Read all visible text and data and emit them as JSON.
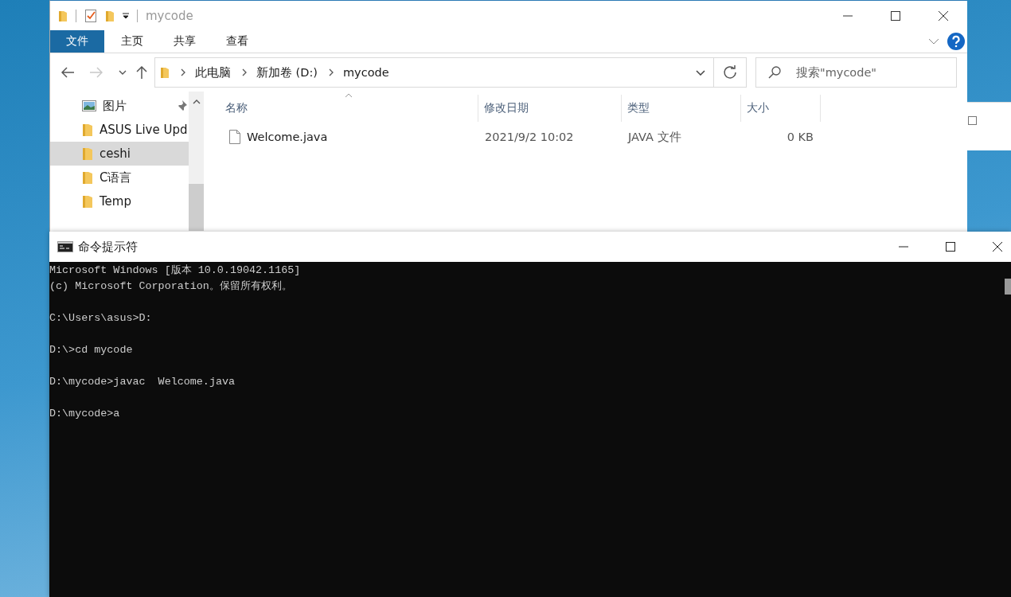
{
  "explorer": {
    "title": "mycode",
    "ribbon_tabs": [
      {
        "label": "文件",
        "kind": "file_menu"
      },
      {
        "label": "主页",
        "kind": "tab"
      },
      {
        "label": "共享",
        "kind": "tab"
      },
      {
        "label": "查看",
        "kind": "tab"
      }
    ],
    "breadcrumb": [
      "此电脑",
      "新加卷 (D:)",
      "mycode"
    ],
    "search": {
      "placeholder": "搜索\"mycode\""
    },
    "nav_items": [
      {
        "label": "图片",
        "kind": "pictures",
        "pinned": true,
        "selected": false
      },
      {
        "label": "ASUS Live Upd",
        "kind": "folder",
        "pinned": false,
        "selected": false
      },
      {
        "label": "ceshi",
        "kind": "folder",
        "pinned": false,
        "selected": true
      },
      {
        "label": "C语言",
        "kind": "folder",
        "pinned": false,
        "selected": false
      },
      {
        "label": "Temp",
        "kind": "folder",
        "pinned": false,
        "selected": false
      }
    ],
    "columns": [
      "名称",
      "修改日期",
      "类型",
      "大小"
    ],
    "files": [
      {
        "name": "Welcome.java",
        "modified": "2021/9/2 10:02",
        "type": "JAVA 文件",
        "size": "0 KB"
      }
    ]
  },
  "console": {
    "title": "命令提示符",
    "blocks": [
      [
        "Microsoft Windows [版本 10.0.19042.1165]",
        "(c) Microsoft Corporation。保留所有权利。"
      ],
      [
        "C:\\Users\\asus>D:"
      ],
      [
        "D:\\>cd mycode"
      ],
      [
        "D:\\mycode>javac  Welcome.java"
      ],
      [
        "D:\\mycode>a"
      ]
    ]
  }
}
